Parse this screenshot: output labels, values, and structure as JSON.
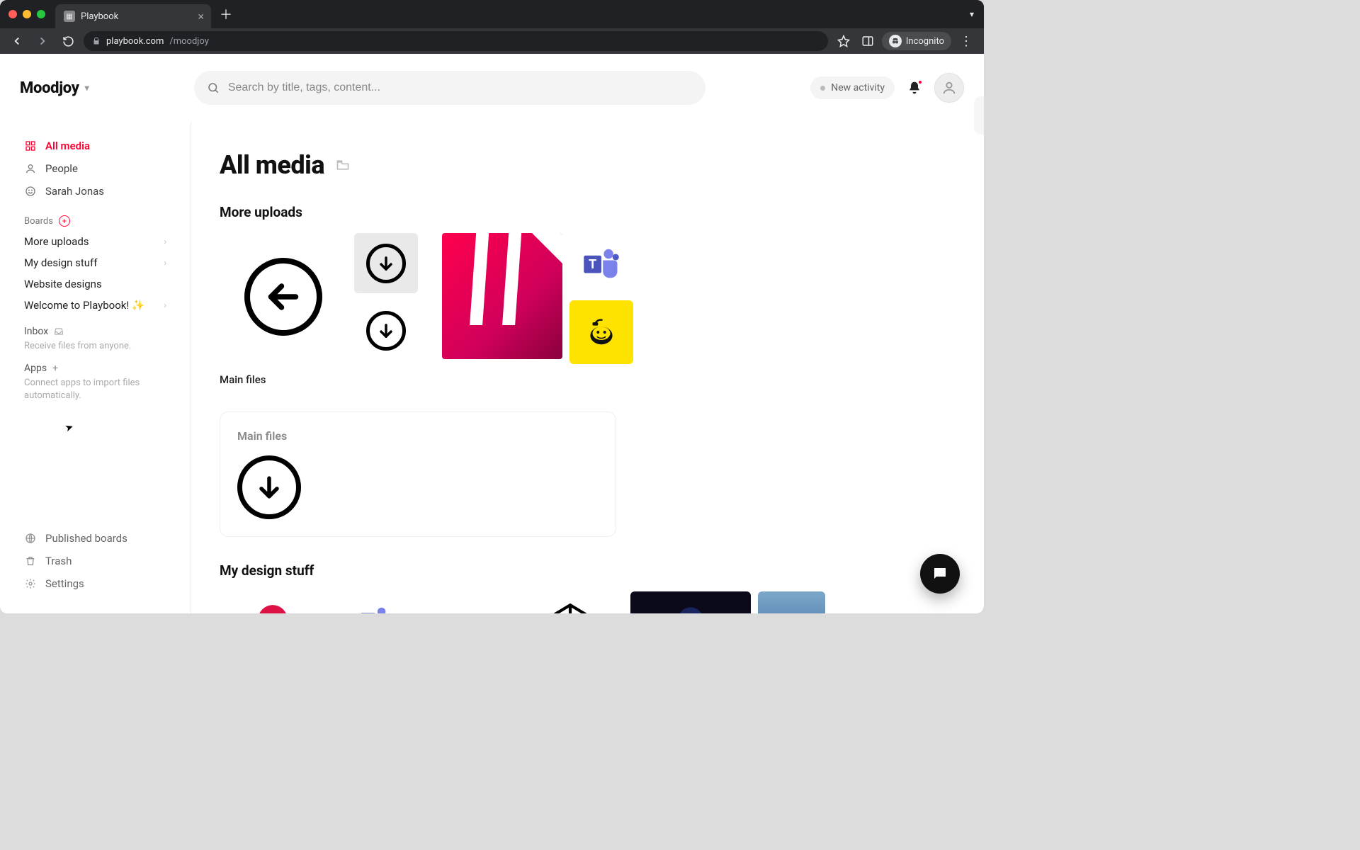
{
  "browser": {
    "tab_title": "Playbook",
    "url_host": "playbook.com",
    "url_path": "/moodjoy",
    "incognito_label": "Incognito"
  },
  "header": {
    "workspace": "Moodjoy",
    "search_placeholder": "Search by title, tags, content...",
    "activity_label": "New activity"
  },
  "sidebar": {
    "nav": [
      {
        "id": "all-media",
        "label": "All media",
        "active": true
      },
      {
        "id": "people",
        "label": "People",
        "active": false
      },
      {
        "id": "sarah",
        "label": "Sarah Jonas",
        "active": false
      }
    ],
    "boards_title": "Boards",
    "boards": [
      {
        "id": "more-uploads",
        "label": "More uploads",
        "has_children": true
      },
      {
        "id": "my-design-stuff",
        "label": "My design stuff",
        "has_children": true
      },
      {
        "id": "website-designs",
        "label": "Website designs",
        "has_children": false
      },
      {
        "id": "welcome",
        "label": "Welcome to Playbook! ✨",
        "has_children": true
      }
    ],
    "inbox": {
      "title": "Inbox",
      "desc": "Receive files from anyone."
    },
    "apps": {
      "title": "Apps",
      "desc": "Connect apps to import files automatically."
    },
    "bottom": [
      {
        "id": "published",
        "label": "Published boards"
      },
      {
        "id": "trash",
        "label": "Trash"
      },
      {
        "id": "settings",
        "label": "Settings"
      }
    ]
  },
  "main": {
    "page_title": "All media",
    "sections": [
      {
        "id": "more-uploads",
        "title": "More uploads",
        "cluster_label": "Main files",
        "sub_board_title": "Main files"
      },
      {
        "id": "my-design-stuff",
        "title": "My design stuff"
      }
    ]
  }
}
